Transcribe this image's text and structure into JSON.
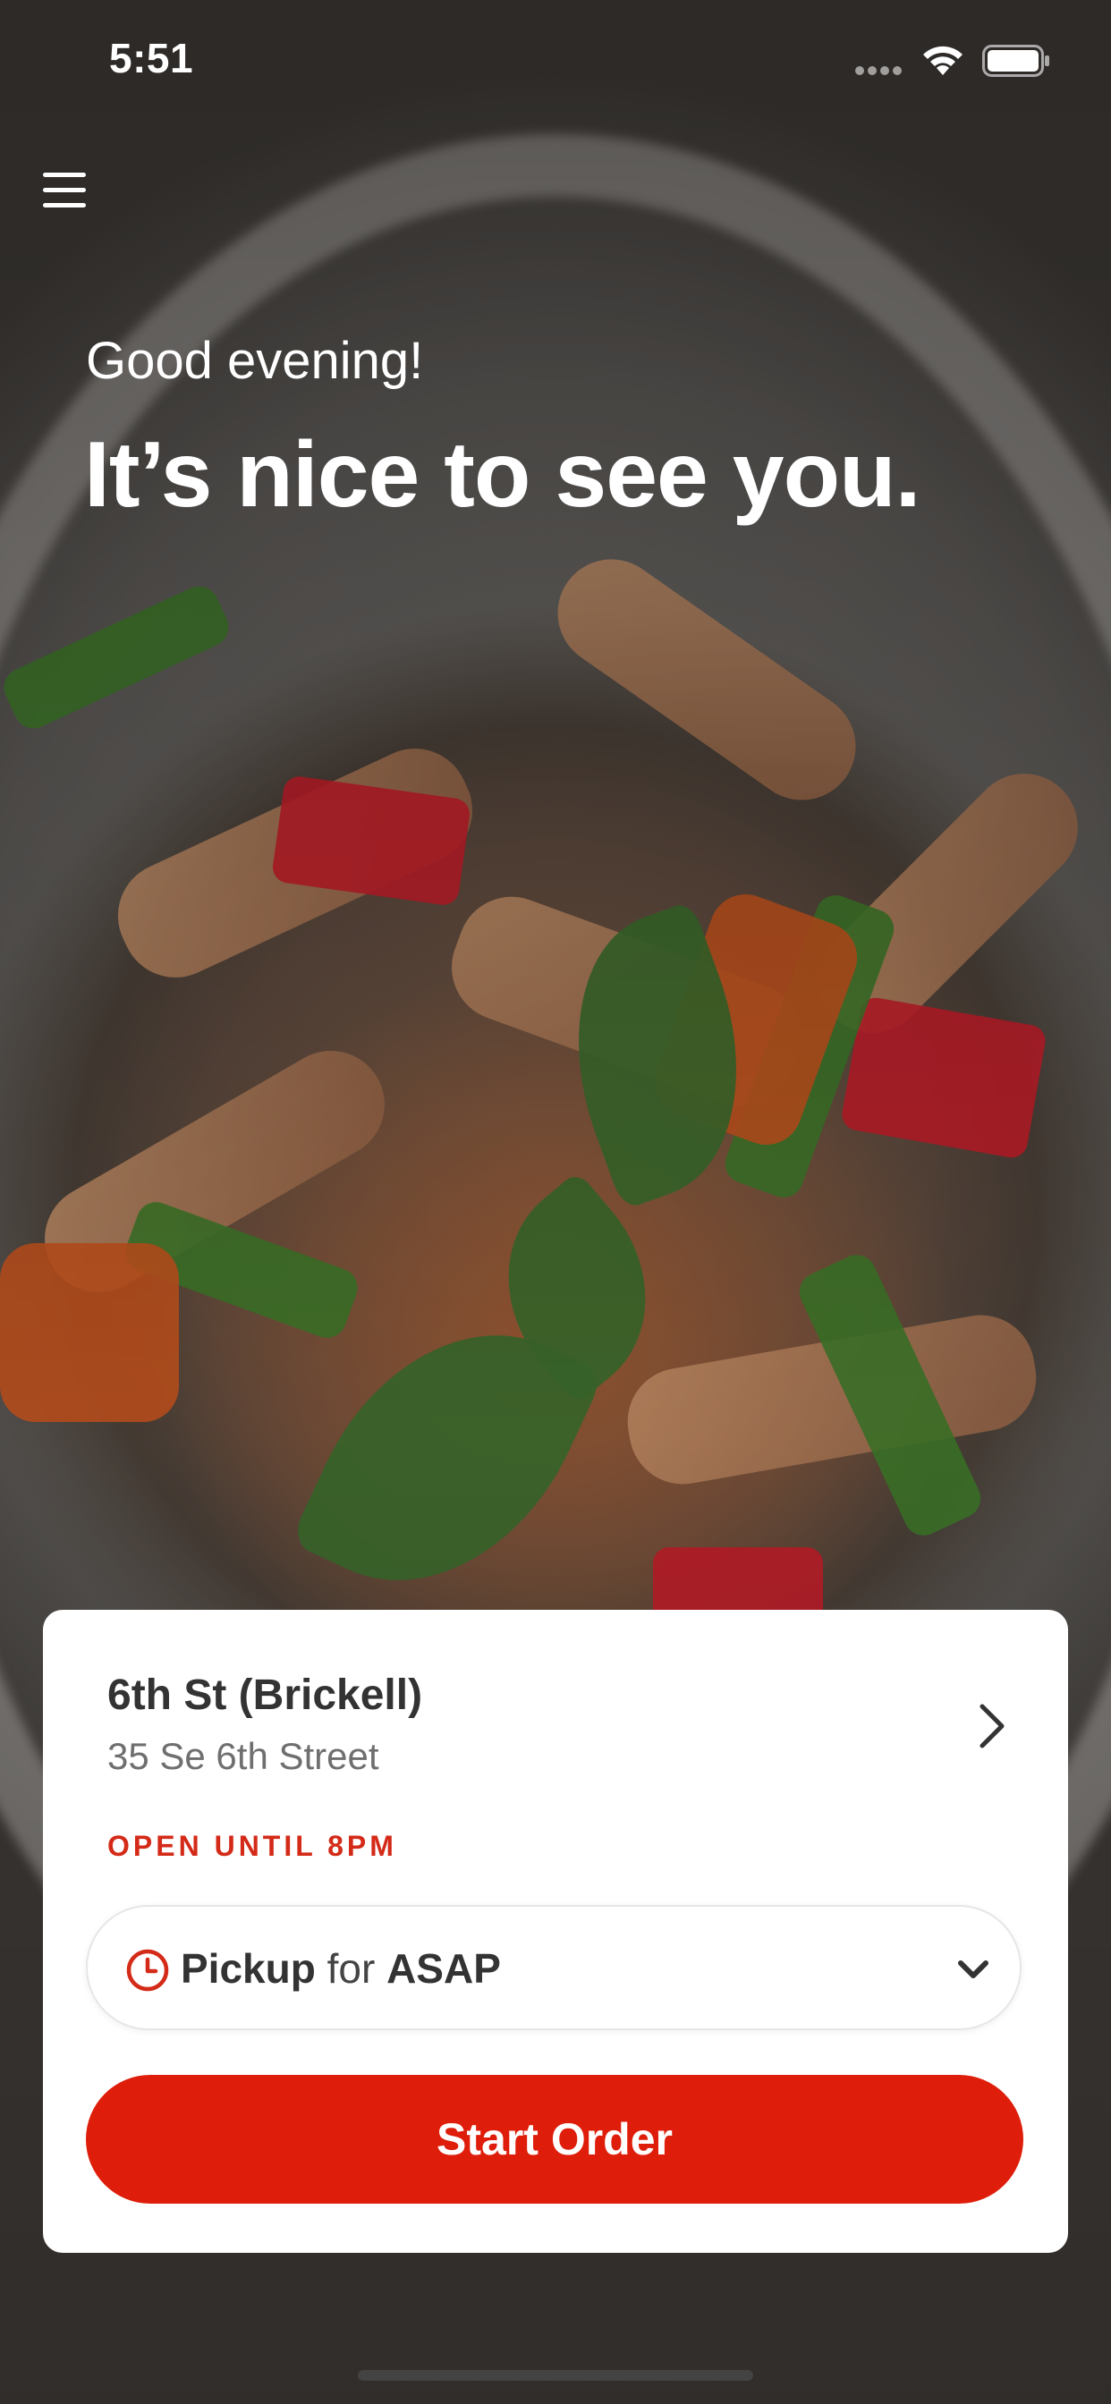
{
  "status_bar": {
    "time": "5:51",
    "icons": [
      "cellular-signal-icon",
      "wifi-icon",
      "battery-icon"
    ]
  },
  "background": {
    "image": "noodle-dish-photo"
  },
  "header": {
    "menu_icon": "hamburger-menu-icon"
  },
  "greeting": {
    "salutation": "Good evening!",
    "headline": "It’s nice to see you."
  },
  "location_card": {
    "store_name": "6th St (Brickell)",
    "address": "35 Se 6th Street",
    "status": "OPEN UNTIL 8PM",
    "status_color": "#d42a18",
    "chevron_icon": "chevron-right-icon"
  },
  "order_type": {
    "icon": "clock-icon",
    "mode": "Pickup",
    "connector": "for",
    "time": "ASAP",
    "dropdown_icon": "chevron-down-icon"
  },
  "actions": {
    "start_order_label": "Start Order",
    "accent_color": "#de1d0a"
  }
}
